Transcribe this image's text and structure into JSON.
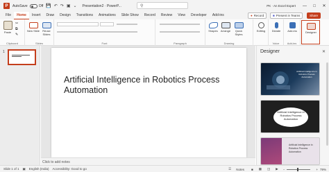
{
  "titlebar": {
    "autosave": "AutoSave",
    "autosave_state": "Off",
    "doc_title": "Presentation2 · PowerP...",
    "search_icon": "search-icon",
    "user": "PK · An Excel Expert"
  },
  "tabs": [
    "File",
    "Home",
    "Insert",
    "Draw",
    "Design",
    "Transitions",
    "Animations",
    "Slide Show",
    "Record",
    "Review",
    "View",
    "Developer",
    "Add-ins"
  ],
  "active_tab": "Home",
  "actions": {
    "record": "Record",
    "present": "Present in Teams",
    "share": "Share"
  },
  "ribbon": {
    "paste": "Paste",
    "new_slide": "New Slide",
    "reuse_slides": "Reuse Slides",
    "shapes": "Shapes",
    "arrange": "Arrange",
    "quick_styles": "Quick Styles",
    "editing": "Editing",
    "dictate": "Dictate",
    "addins": "Add-ins",
    "designer": "Designer",
    "groups": {
      "clipboard": "Clipboard",
      "slides": "Slides",
      "font": "Font",
      "paragraph": "Paragraph",
      "drawing": "Drawing",
      "voice": "Voice",
      "addins": "Add-ins"
    }
  },
  "slides_pane": {
    "slide_number": "1"
  },
  "slide": {
    "title": "Artificial Intelligence in Robotics Process Automation"
  },
  "notes_placeholder": "Click to add notes",
  "designer": {
    "title": "Designer",
    "cards": [
      {
        "text": "Artificial Intelligence in Robotics Process Automation"
      },
      {
        "text": "Artificial Intelligence in Robotics Process Automation"
      },
      {
        "text": "Artificial Intelligence in Robotics Process Automation"
      }
    ]
  },
  "status": {
    "slide_of": "Slide 1 of 1",
    "language": "English (India)",
    "accessibility": "Accessibility: Good to go",
    "notes": "Notes",
    "zoom": "79%"
  },
  "colors": {
    "accent": "#c43e1c",
    "ribbon_bg": "#fbfbfb",
    "titlebar_bg": "#f3f3f3"
  }
}
